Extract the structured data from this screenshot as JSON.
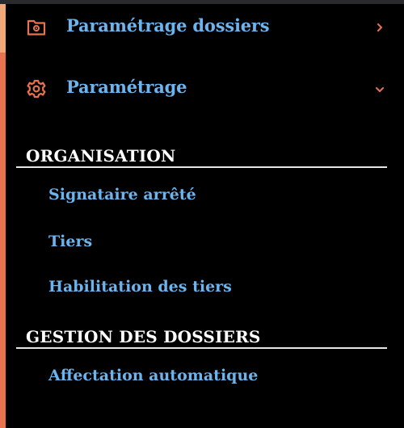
{
  "menu": {
    "items": [
      {
        "label": "Paramétrage dossiers",
        "icon": "folder-gear-icon",
        "state": "collapsed"
      },
      {
        "label": "Paramétrage",
        "icon": "gear-icon",
        "state": "expanded"
      }
    ]
  },
  "sections": [
    {
      "title": "ORGANISATION",
      "items": [
        {
          "label": "Signataire arrêté"
        },
        {
          "label": "Tiers"
        },
        {
          "label": "Habilitation des tiers"
        }
      ]
    },
    {
      "title": "GESTION DES DOSSIERS",
      "items": [
        {
          "label": "Affectation automatique"
        }
      ]
    }
  ],
  "colors": {
    "background": "#000000",
    "link": "#6cb4ee",
    "accent": "#e8734f",
    "heading": "#ffffff"
  }
}
